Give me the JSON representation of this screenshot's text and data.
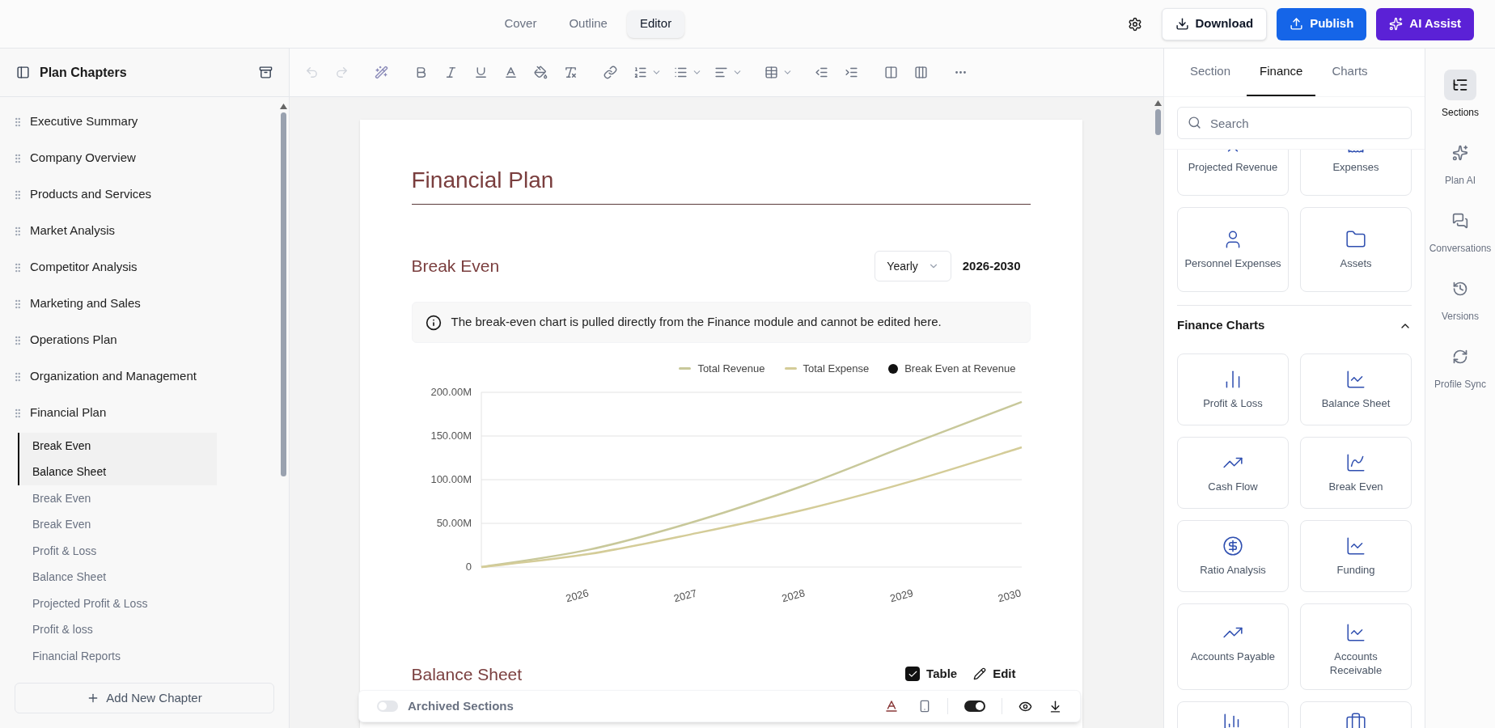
{
  "top_tabs": [
    {
      "label": "Cover",
      "selected": false
    },
    {
      "label": "Outline",
      "selected": false
    },
    {
      "label": "Editor",
      "selected": true
    }
  ],
  "top_actions": [
    {
      "label": "Download",
      "kind": "plain"
    },
    {
      "label": "Publish",
      "kind": "primary"
    },
    {
      "label": "AI Assist",
      "kind": "accent"
    }
  ],
  "sidebar": {
    "title": "Plan Chapters",
    "chapters": [
      {
        "label": "Executive Summary"
      },
      {
        "label": "Company Overview"
      },
      {
        "label": "Products and Services"
      },
      {
        "label": "Market Analysis"
      },
      {
        "label": "Competitor Analysis"
      },
      {
        "label": "Marketing and Sales"
      },
      {
        "label": "Operations Plan"
      },
      {
        "label": "Organization and Management"
      },
      {
        "label": "Financial Plan",
        "children": [
          {
            "label": "Break Even",
            "selected": true
          },
          {
            "label": "Balance Sheet",
            "selected": true
          },
          {
            "label": "Break Even",
            "selected": false
          },
          {
            "label": "Break Even",
            "selected": false
          },
          {
            "label": "Profit & Loss",
            "selected": false
          },
          {
            "label": "Balance Sheet",
            "selected": false
          },
          {
            "label": "Projected Profit & Loss",
            "selected": false
          },
          {
            "label": "Profit & loss",
            "selected": false
          },
          {
            "label": "Financial Reports",
            "selected": false
          }
        ]
      }
    ],
    "add_button": "Add New Chapter"
  },
  "toolbar": [
    {
      "kind": "undo",
      "disabled": true
    },
    {
      "kind": "redo",
      "disabled": true
    },
    {
      "kind": "wand",
      "disabled": false
    },
    {
      "kind": "bold",
      "disabled": false
    },
    {
      "kind": "italic",
      "disabled": false
    },
    {
      "kind": "underline",
      "disabled": false
    },
    {
      "kind": "color",
      "disabled": false
    },
    {
      "kind": "fill",
      "disabled": false
    },
    {
      "kind": "clear",
      "disabled": false
    },
    {
      "kind": "link",
      "disabled": false
    },
    {
      "kind": "ordered",
      "disabled": false
    },
    {
      "kind": "bullets",
      "disabled": false
    },
    {
      "kind": "align",
      "disabled": false
    },
    {
      "kind": "table",
      "disabled": false
    },
    {
      "kind": "outdent",
      "disabled": false
    },
    {
      "kind": "indent",
      "disabled": false
    },
    {
      "kind": "cols2",
      "disabled": false
    },
    {
      "kind": "cols3",
      "disabled": false
    },
    {
      "kind": "more",
      "disabled": false
    }
  ],
  "document": {
    "title": "Financial Plan",
    "break_even": {
      "heading": "Break Even",
      "period": "Yearly",
      "range": "2026-2030",
      "notice": "The break-even chart is pulled directly from the Finance module and cannot be edited here.",
      "chart_data": {
        "type": "line",
        "grid": true,
        "x": [
          2025,
          2026,
          2027,
          2028,
          2029,
          2030
        ],
        "xticks": [
          2026,
          2027,
          2028,
          2029,
          2030
        ],
        "xlim": [
          2025,
          2030
        ],
        "ylim": [
          0,
          200
        ],
        "yticks": [
          {
            "value": 0,
            "label": "0"
          },
          {
            "value": 50,
            "label": "50.00M"
          },
          {
            "value": 100,
            "label": "100.00M"
          },
          {
            "value": 150,
            "label": "150.00M"
          },
          {
            "value": 200,
            "label": "200.00M"
          }
        ],
        "series": [
          {
            "name": "Total Revenue",
            "color": "#c8c89a",
            "values": [
              0,
              20,
              53,
              94,
              142,
              189
            ]
          },
          {
            "name": "Total Expense",
            "color": "#d4cc98",
            "values": [
              0,
              15,
              39,
              66,
              99,
              137
            ]
          },
          {
            "name": "Break Even at Revenue",
            "color": "#111111",
            "values": [
              null,
              null,
              null,
              null,
              null,
              null
            ]
          }
        ]
      }
    },
    "balance_sheet": {
      "heading": "Balance Sheet",
      "table_label": "Table",
      "table_checked": true,
      "edit_label": "Edit"
    },
    "bottom_bar": {
      "archived_label": "Archived Sections",
      "archived_on": false,
      "view_toggle_on": true
    }
  },
  "right_panel": {
    "tabs": [
      {
        "label": "Section",
        "selected": false
      },
      {
        "label": "Finance",
        "selected": true
      },
      {
        "label": "Charts",
        "selected": false
      }
    ],
    "search_placeholder": "Search",
    "items": [
      {
        "label": "Projected Revenue"
      },
      {
        "label": "Expenses"
      },
      {
        "label": "Personnel Expenses"
      },
      {
        "label": "Assets"
      }
    ],
    "charts_section": {
      "title": "Finance Charts",
      "expanded": true,
      "items": [
        {
          "label": "Profit & Loss"
        },
        {
          "label": "Balance Sheet"
        },
        {
          "label": "Cash Flow"
        },
        {
          "label": "Break Even"
        },
        {
          "label": "Ratio Analysis"
        },
        {
          "label": "Funding"
        },
        {
          "label": "Accounts Payable"
        },
        {
          "label": "Accounts Receivable"
        }
      ]
    }
  },
  "rail": [
    {
      "label": "Sections",
      "selected": true
    },
    {
      "label": "Plan AI",
      "selected": false
    },
    {
      "label": "Conversations",
      "selected": false
    },
    {
      "label": "Versions",
      "selected": false
    },
    {
      "label": "Profile Sync",
      "selected": false
    }
  ]
}
